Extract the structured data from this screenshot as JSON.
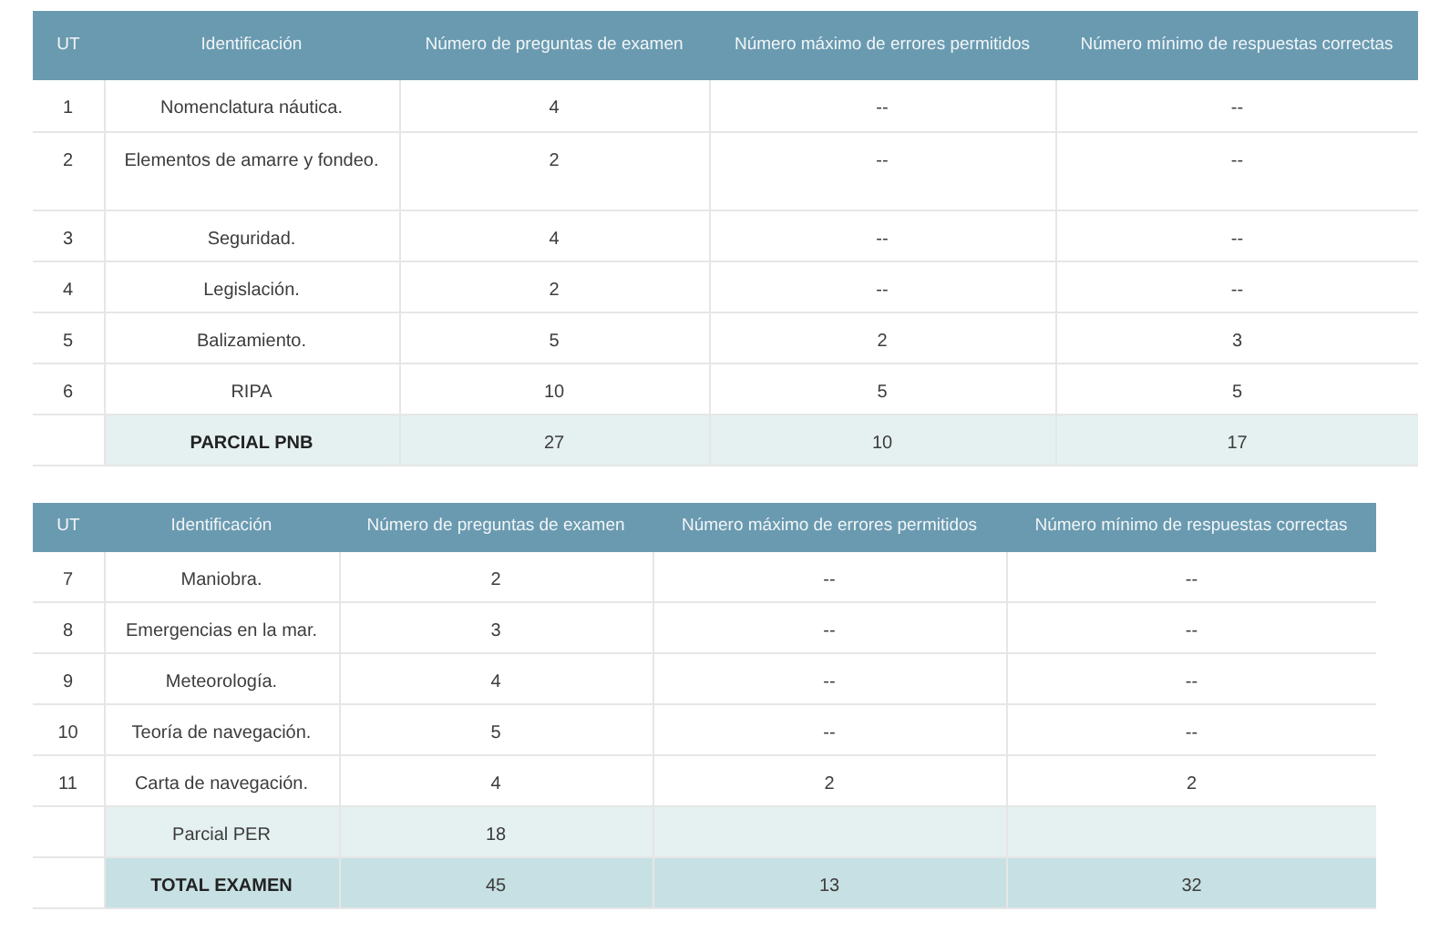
{
  "tables": [
    {
      "columns": [
        "UT",
        "Identificación",
        "Número de preguntas de examen",
        "Número máximo de errores permitidos",
        "Número mínimo de respuestas correctas"
      ],
      "rows": [
        {
          "kind": "item",
          "ut": "1",
          "name": "Nomenclatura náutica.",
          "questions": "4",
          "max_errors": "--",
          "min_correct": "--"
        },
        {
          "kind": "item",
          "ut": "2",
          "name": "Elementos de amarre y fondeo.",
          "questions": "2",
          "max_errors": "--",
          "min_correct": "--"
        },
        {
          "kind": "item",
          "ut": "3",
          "name": "Seguridad.",
          "questions": "4",
          "max_errors": "--",
          "min_correct": "--"
        },
        {
          "kind": "item",
          "ut": "4",
          "name": "Legislación.",
          "questions": "2",
          "max_errors": "--",
          "min_correct": "--"
        },
        {
          "kind": "item",
          "ut": "5",
          "name": "Balizamiento.",
          "questions": "5",
          "max_errors": "2",
          "min_correct": "3"
        },
        {
          "kind": "item",
          "ut": "6",
          "name": "RIPA",
          "questions": "10",
          "max_errors": "5",
          "min_correct": "5"
        },
        {
          "kind": "partial",
          "bold": true,
          "name": "PARCIAL PNB",
          "questions": "27",
          "max_errors": "10",
          "min_correct": "17"
        }
      ]
    },
    {
      "columns": [
        "UT",
        "Identificación",
        "Número de preguntas de examen",
        "Número máximo de errores permitidos",
        "Número mínimo de respuestas correctas"
      ],
      "rows": [
        {
          "kind": "item",
          "ut": "7",
          "name": "Maniobra.",
          "questions": "2",
          "max_errors": "--",
          "min_correct": "--"
        },
        {
          "kind": "item",
          "ut": "8",
          "name": "Emergencias en la mar.",
          "questions": "3",
          "max_errors": "--",
          "min_correct": "--"
        },
        {
          "kind": "item",
          "ut": "9",
          "name": "Meteorología.",
          "questions": "4",
          "max_errors": "--",
          "min_correct": "--"
        },
        {
          "kind": "item",
          "ut": "10",
          "name": "Teoría de navegación.",
          "questions": "5",
          "max_errors": "--",
          "min_correct": "--"
        },
        {
          "kind": "item",
          "ut": "11",
          "name": "Carta de navegación.",
          "questions": "4",
          "max_errors": "2",
          "min_correct": "2"
        },
        {
          "kind": "partial",
          "bold": false,
          "name": "Parcial PER",
          "questions": "18"
        },
        {
          "kind": "total",
          "bold": true,
          "name": "TOTAL EXAMEN",
          "questions": "45",
          "max_errors": "13",
          "min_correct": "32"
        }
      ]
    }
  ]
}
